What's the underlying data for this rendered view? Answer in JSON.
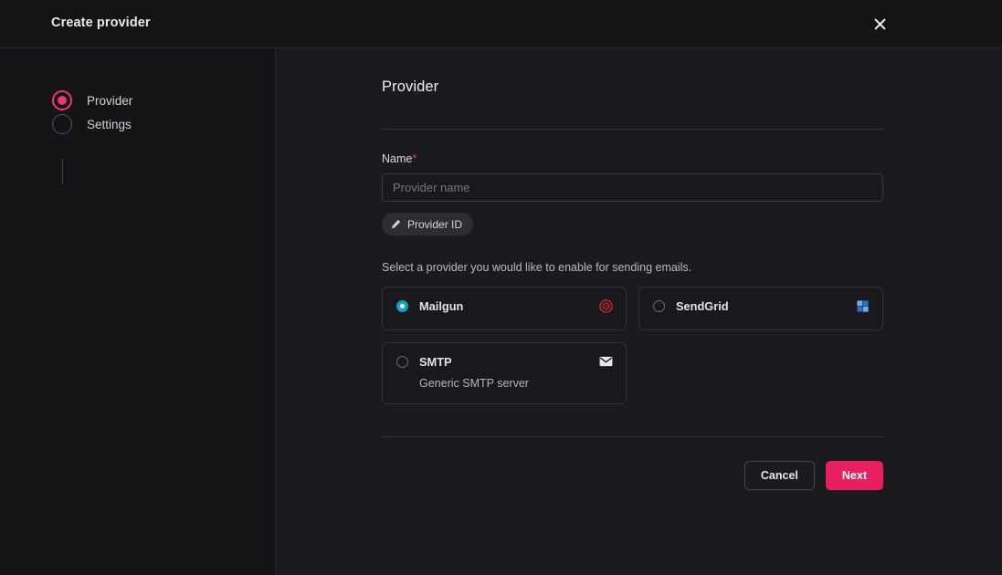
{
  "modal": {
    "title": "Create provider",
    "close_icon": "close-icon"
  },
  "stepper": {
    "steps": [
      {
        "label": "Provider",
        "state": "active"
      },
      {
        "label": "Settings",
        "state": "inactive"
      }
    ]
  },
  "main": {
    "section_title": "Provider",
    "name_field": {
      "label": "Name",
      "required_mark": "*",
      "placeholder": "Provider name",
      "value": ""
    },
    "provider_id_button": {
      "label": "Provider ID",
      "icon": "pencil-icon"
    },
    "helper_text": "Select a provider you would like to enable for sending emails.",
    "providers": [
      {
        "name": "Mailgun",
        "subtitle": "",
        "selected": true,
        "icon": "mailgun-icon",
        "icon_color": "#c22b2b"
      },
      {
        "name": "SendGrid",
        "subtitle": "",
        "selected": false,
        "icon": "sendgrid-icon",
        "icon_color": "#6aaef0"
      },
      {
        "name": "SMTP",
        "subtitle": "Generic SMTP server",
        "selected": false,
        "icon": "envelope-icon",
        "icon_color": "#e9e9ec"
      }
    ]
  },
  "footer": {
    "cancel_label": "Cancel",
    "next_label": "Next"
  },
  "colors": {
    "accent_pink": "#e81f5f",
    "step_active": "#ea3a6c",
    "radio_selected": "#14a0cd",
    "required_star": "#e2473e",
    "panel_bg": "#1b1b1f",
    "sidebar_bg": "#141416"
  }
}
